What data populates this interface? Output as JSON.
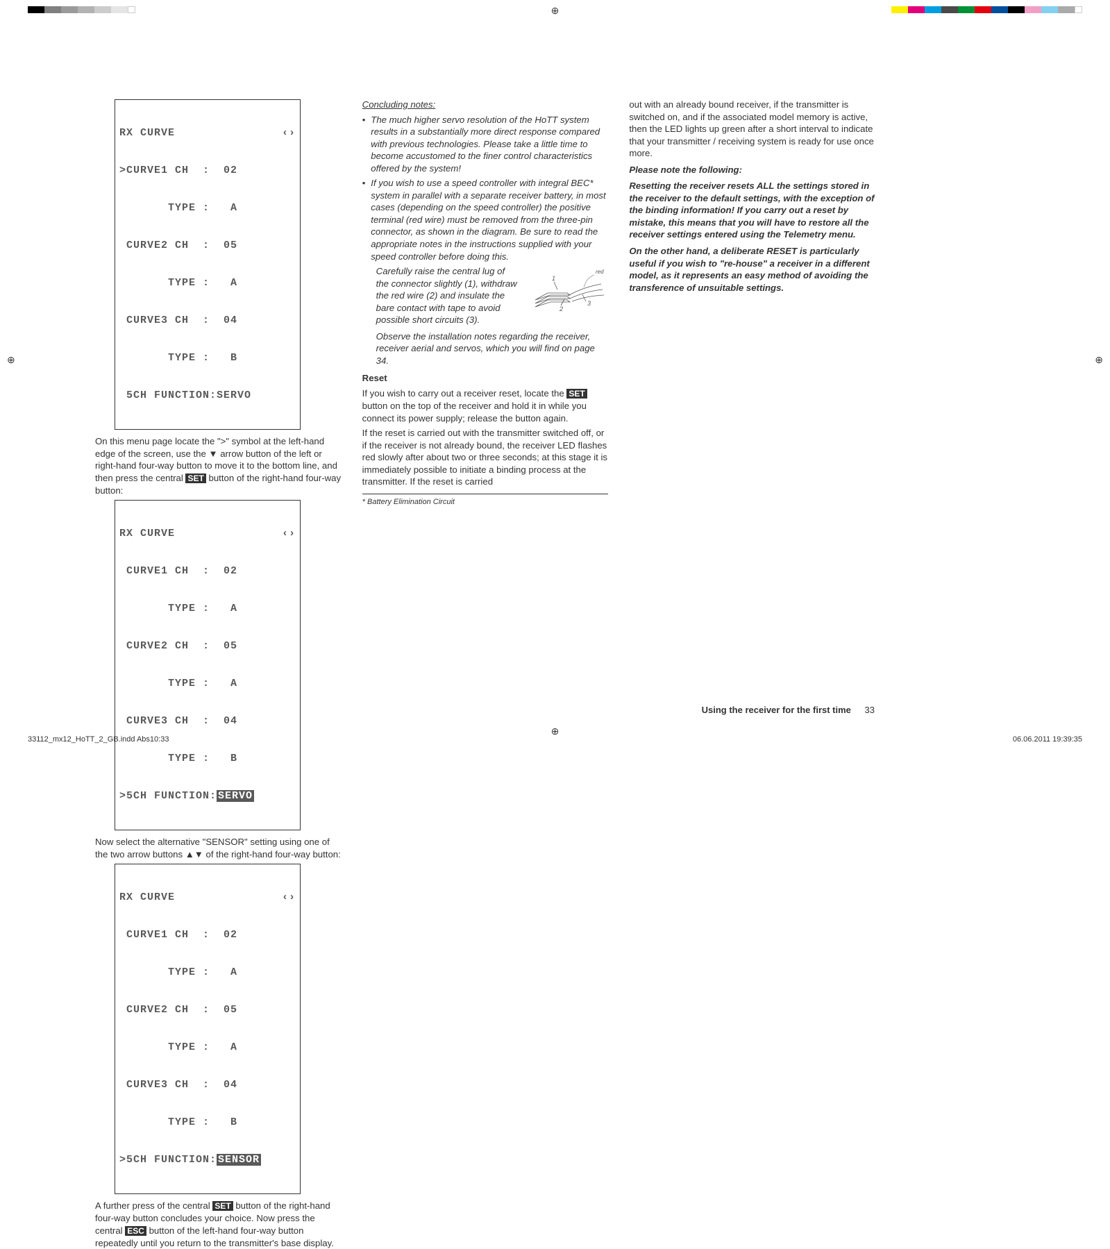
{
  "color_bar_left": [
    "#000",
    "#7f7f7f",
    "#9a9a9a",
    "#b2b2b2",
    "#cccccc",
    "#e5e5e5"
  ],
  "color_bar_right": [
    "#fff000",
    "#e2007a",
    "#009ee0",
    "#4a4a4a",
    "#009036",
    "#e3000f",
    "#004f9e",
    "#000000",
    "#f29fc5",
    "#83d0f0",
    "#aaaaaa",
    "#9ccf84"
  ],
  "lcd1": {
    "title": "RX CURVE",
    "arrow": "‹›",
    "l1": ">CURVE1 CH  :  02",
    "l2": "       TYPE :   A",
    "l3": " CURVE2 CH  :  05",
    "l4": "       TYPE :   A",
    "l5": " CURVE3 CH  :  04",
    "l6": "       TYPE :   B",
    "l7": " 5CH FUNCTION:SERVO"
  },
  "p1a": "On this menu page locate the \">\" symbol at the left-hand edge of the screen, use the ▼ arrow button of the left or right-hand four-way button to move it to the bottom line, and then press the central ",
  "p1b": "SET",
  "p1c": " button of the right-hand four-way button:",
  "lcd2": {
    "title": "RX CURVE",
    "arrow": "‹›",
    "l1": " CURVE1 CH  :  02",
    "l2": "       TYPE :   A",
    "l3": " CURVE2 CH  :  05",
    "l4": "       TYPE :   A",
    "l5": " CURVE3 CH  :  04",
    "l6": "       TYPE :   B",
    "l7a": ">5CH FUNCTION:",
    "l7b": "SERVO"
  },
  "p2": "Now select the alternative \"SENSOR\" setting using one of the two arrow buttons ▲▼ of the right-hand four-way button:",
  "lcd3": {
    "title": "RX CURVE",
    "arrow": "‹›",
    "l1": " CURVE1 CH  :  02",
    "l2": "       TYPE :   A",
    "l3": " CURVE2 CH  :  05",
    "l4": "       TYPE :   A",
    "l5": " CURVE3 CH  :  04",
    "l6": "       TYPE :   B",
    "l7a": ">5CH FUNCTION:",
    "l7b": "SENSOR"
  },
  "p3a": "A further press of the central ",
  "p3b": "SET",
  "p3c": " button of the right-hand four-way button concludes your choice. Now press the central ",
  "p3d": "ESC",
  "p3e": " button of the left-hand four-way button repeatedly until you return to the transmitter's base display.",
  "concl_h": "Concluding notes:",
  "b1": "The much higher servo resolution of the HoTT system results in a substantially more direct response compared with previous technologies. Please take a little time to become accustomed to the finer control characteristics offered by the system!",
  "b2": "If you wish to use a speed controller with integral BEC* system in parallel with a separate receiver battery, in most cases (depending on the speed controller) the positive terminal (red wire) must be removed from the three-pin connector, as shown in the diagram. Be sure to read the appropriate notes in the instructions supplied with your speed controller before doing this.",
  "b2b": "Carefully raise the central lug of the connector slightly (1), withdraw the red wire (2) and insulate the bare contact with tape to avoid possible short circuits (3).",
  "b2c": "Observe the installation notes regarding the receiver, receiver aerial and servos, which you will find on page 34.",
  "diagram": {
    "red": "red",
    "n1": "1",
    "n2": "2",
    "n3": "3"
  },
  "reset_h": "Reset",
  "r1a": "If you wish to carry out a receiver reset, locate the ",
  "r1b": "SET",
  "r1c": " button on the top of the receiver and hold it in while you connect its power supply; release the button again.",
  "r2": "If the reset is carried out with the transmitter switched off, or if the receiver is not already bound, the receiver LED flashes red slowly after about two or three seconds; at this stage it is immediately possible to initiate a binding process at the transmitter. If the reset is carried",
  "foot": "*   Battery Elimination Circuit",
  "c3p1": "out with an already bound receiver, if the transmitter is switched on, and if the associated model memory is active, then the LED lights up green after a short interval to indicate that your transmitter / receiving system is ready for use once more.",
  "note_h": "Please note the following:",
  "n1": "Resetting the receiver resets ALL the settings stored in the receiver to the default settings, with the exception of the binding information! If you carry out a reset by mistake, this means that you will have to restore all the receiver settings entered using the Telemetry menu.",
  "n2": "On the other hand, a deliberate RESET is particularly useful if you wish to \"re-house\" a receiver in a different model, as it represents an easy method of avoiding the transference of unsuitable settings.",
  "footer_title": "Using the receiver for the first time",
  "page_num": "33",
  "indd_left": "33112_mx12_HoTT_2_GB.indd   Abs10:33",
  "indd_right": "06.06.2011   19:39:35"
}
